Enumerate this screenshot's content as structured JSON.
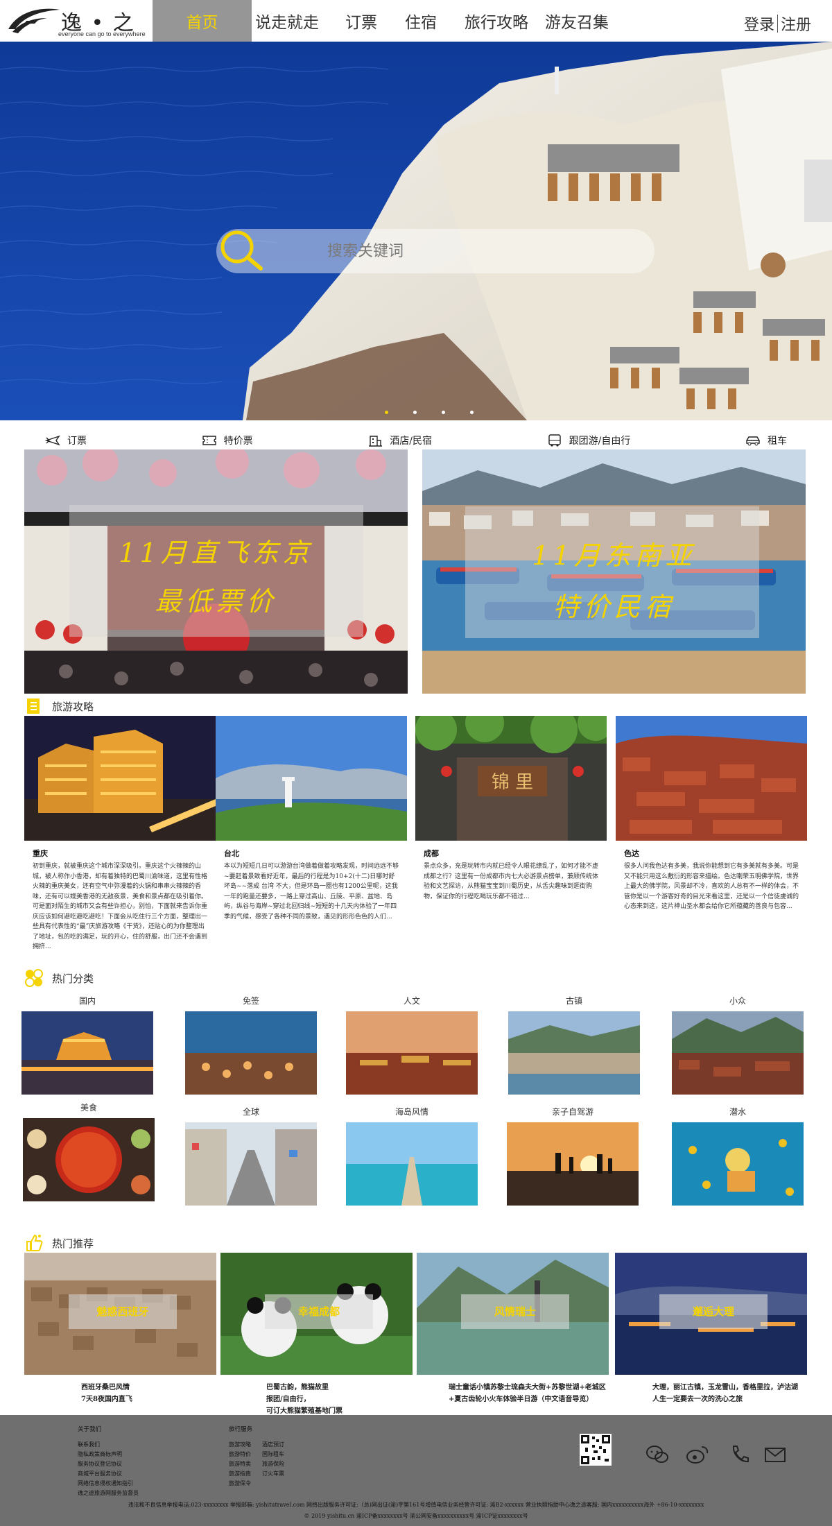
{
  "header": {
    "logo_name": "逸 • 之途",
    "logo_slogan": "everyone can go to everywhere",
    "nav": [
      "首页",
      "说走就走",
      "订票",
      "住宿",
      "旅行攻略",
      "游友召集"
    ],
    "login": "登录",
    "register": "注册"
  },
  "banner": {
    "search_placeholder": "搜索关键词",
    "slide_count": 4,
    "active_slide": 1
  },
  "services": [
    "订票",
    "特价票",
    "酒店/民宿",
    "跟团游/自由行",
    "租车"
  ],
  "promos": [
    {
      "line1": "11月直飞东京",
      "line2": "最低票价"
    },
    {
      "line1": "11月东南亚",
      "line2": "特价民宿"
    }
  ],
  "guides_section": {
    "title": "旅游攻略",
    "items": [
      {
        "name": "重庆",
        "desc": "初到重庆，就被重庆这个城市深深吸引。重庆这个火辣辣的山城，被人称作小香港，却有着独特的巴蜀川渝味道，这里有性格火辣的重庆美女，还有空气中弥漫着的火锅和串串火辣辣的香味，还有可以媲美香港的无敌夜景，美食和景点都在吸引着你。可是面对陌生的城市又会有些许担心，别怕，下面就来告诉你重庆应该如何避吃避吃避吃！下面会从吃住行三个方面，整理出一些具有代表性的“最”庆旅游攻略《干货》，还贴心的为你整理出了地址，包的吃的满足，玩的开心，住的舒服，出门还不会遇到拥挤..."
      },
      {
        "name": "台北",
        "desc": "本以为短短几日可以游游台湾做着做着攻略发现，时间远远不够~要赶着景致看好近年，最后的行程是为10+2(十二)日哪时舒坏岛~~落成 台湾 不大，但是环岛一圈也有1200公里呢，这我一年的跑量还要多，一路上穿过高山、丘陵、平原、盆地、岛屿，纵谷与海岸~穿过北回归线~短短的十几天内体验了一年四季的气候，感受了各种不同的景致，遇见的形形色色的人们..."
      },
      {
        "name": "成都",
        "desc": "景点众多，充是玩转市内就已经令人眼花缭乱了，如何才能不虚成都之行？这里有一份成都市内七大必游景点榜单，兼顾传统体验和文艺探访，从熊猫宝宝到川蜀历史，从舌尖趣味到逛街购物，保证你的行程吃喝玩乐都不错过..."
      },
      {
        "name": "色达",
        "desc": "很多人问我色达有多美，我说你能想到它有多美就有多美。可是又不能只用这么敷衍的形容来描绘。色达喇荣五明佛学院，世界上最大的佛学院，风景却不冷，喜欢的人总有不一样的体会，不管你是以一个游客好奇的目光来看这里，还是以一个信徒虔诚的心态来到这，这片神山圣水都会给你它所蕴藏的善良与包容..."
      }
    ]
  },
  "hot_categories": {
    "title": "热门分类",
    "row1": [
      "国内",
      "免签",
      "人文",
      "古镇",
      "小众"
    ],
    "row2": [
      "美食",
      "全球",
      "海岛风情",
      "亲子自驾游",
      "潜水"
    ]
  },
  "hot_recommend": {
    "title": "热门推荐",
    "items": [
      {
        "tag": "魅惑西班牙",
        "desc": "西班牙桑巴风情\n7天8夜国内直飞"
      },
      {
        "tag": "幸福成都",
        "desc": "巴蜀古韵，熊猫故里\n报团/自由行，\n可订大熊猫繁殖基地门票"
      },
      {
        "tag": "风情瑞士",
        "desc": "瑞士童话小镇苏黎士琉森夫大街+苏黎世湖+老城区\n+夏古齿轮小火车体验半日游（中文语音导览）"
      },
      {
        "tag": "邂逅大理",
        "desc": "大理，丽江古镇，玉龙雪山，香格里拉，泸沽湖\n人生一定要去一次的洗心之旅"
      }
    ]
  },
  "footer": {
    "about_title": "关于我们",
    "about_links": [
      "联系我们",
      "隐私政策商标声明",
      "服务协议登记协议",
      "商城平台服务协议",
      "网络信息侵权通知指引",
      "逸之途旅游网服务监督员"
    ],
    "travel_title": "旅行服务",
    "travel_col1": [
      "旅游攻略",
      "旅游特价",
      "旅游特卖",
      "旅游指南",
      "旅游保令"
    ],
    "travel_col2": [
      "酒店预订",
      "国际租车",
      "旅游保险",
      "订火车票"
    ],
    "copyright1": "违法和不良信息举报电话:023-xxxxxxxx 举报邮箱: yishitutravel.com 网络出版服务许可证:（总)网出证(渝)字第161号增值电信业务经营许可证: 渝B2-xxxxxx 营业执照指助中心逸之途客服: 国内xxxxxxxxxx海外 +86-10-xxxxxxxx",
    "copyright2": "© 2019 yishitu.cn 渝ICP备xxxxxxxx号 渝公网安备xxxxxxxxxx号 渝ICP证xxxxxxxx号"
  },
  "colors": {
    "accent": "#f4d300",
    "nav_active_bg": "#969696",
    "footer_bg": "#6f6f6f",
    "sea": "#123f9e"
  }
}
